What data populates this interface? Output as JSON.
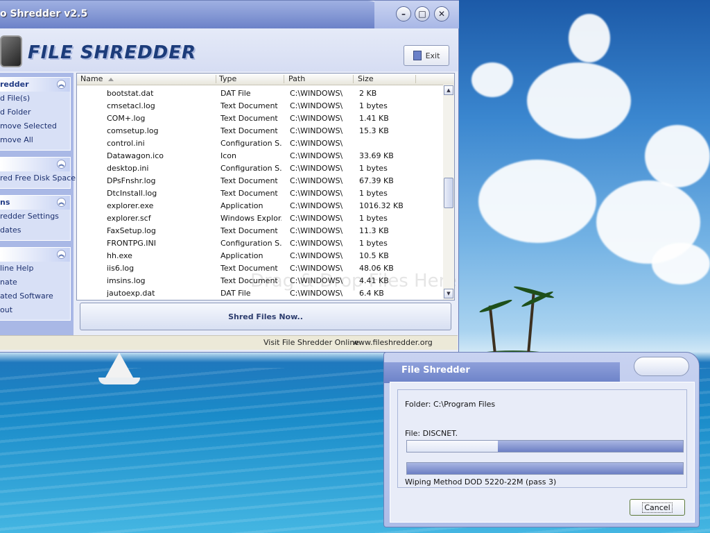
{
  "app": {
    "title": "o Shredder v2.5",
    "logo_text": "FILE SHREDDER",
    "exit_label": "Exit"
  },
  "window_controls": {
    "minimize": "–",
    "maximize": "□",
    "close": "✕"
  },
  "sidebar": {
    "panels": [
      {
        "title": "redder",
        "items": [
          "d File(s)",
          "d Folder",
          "move Selected",
          "move All"
        ]
      },
      {
        "title": "",
        "items": [
          "red Free Disk Space"
        ]
      },
      {
        "title": "ns",
        "items": [
          "redder Settings",
          "dates"
        ]
      },
      {
        "title": "",
        "items": [
          "line Help",
          "nate",
          "ated Software",
          "out"
        ]
      }
    ]
  },
  "file_list": {
    "columns": [
      "Name",
      "Type",
      "Path",
      "Size"
    ],
    "rows": [
      {
        "name": "bootstat.dat",
        "type": "DAT File",
        "path": "C:\\WINDOWS\\",
        "size": "2 KB"
      },
      {
        "name": "cmsetacl.log",
        "type": "Text Document",
        "path": "C:\\WINDOWS\\",
        "size": "1 bytes"
      },
      {
        "name": "COM+.log",
        "type": "Text Document",
        "path": "C:\\WINDOWS\\",
        "size": "1.41 KB"
      },
      {
        "name": "comsetup.log",
        "type": "Text Document",
        "path": "C:\\WINDOWS\\",
        "size": "15.3 KB"
      },
      {
        "name": "control.ini",
        "type": "Configuration S...",
        "path": "C:\\WINDOWS\\",
        "size": ""
      },
      {
        "name": "Datawagon.ico",
        "type": "Icon",
        "path": "C:\\WINDOWS\\",
        "size": "33.69 KB"
      },
      {
        "name": "desktop.ini",
        "type": "Configuration S...",
        "path": "C:\\WINDOWS\\",
        "size": "1 bytes"
      },
      {
        "name": "DPsFnshr.log",
        "type": "Text Document",
        "path": "C:\\WINDOWS\\",
        "size": "67.39 KB"
      },
      {
        "name": "DtcInstall.log",
        "type": "Text Document",
        "path": "C:\\WINDOWS\\",
        "size": "1 bytes"
      },
      {
        "name": "explorer.exe",
        "type": "Application",
        "path": "C:\\WINDOWS\\",
        "size": "1016.32 KB"
      },
      {
        "name": "explorer.scf",
        "type": "Windows Explor...",
        "path": "C:\\WINDOWS\\",
        "size": "1 bytes"
      },
      {
        "name": "FaxSetup.log",
        "type": "Text Document",
        "path": "C:\\WINDOWS\\",
        "size": "11.3 KB"
      },
      {
        "name": "FRONTPG.INI",
        "type": "Configuration S...",
        "path": "C:\\WINDOWS\\",
        "size": "1 bytes"
      },
      {
        "name": "hh.exe",
        "type": "Application",
        "path": "C:\\WINDOWS\\",
        "size": "10.5 KB"
      },
      {
        "name": "iis6.log",
        "type": "Text Document",
        "path": "C:\\WINDOWS\\",
        "size": "48.06 KB"
      },
      {
        "name": "imsins.log",
        "type": "Text Document",
        "path": "C:\\WINDOWS\\",
        "size": "4.41 KB"
      },
      {
        "name": "jautoexp.dat",
        "type": "DAT File",
        "path": "C:\\WINDOWS\\",
        "size": "6.4 KB"
      }
    ],
    "watermark": "Drag & Drop Files Here"
  },
  "shred_button": "Shred Files Now..",
  "statusbar": {
    "visit_text": "Visit File Shredder Online",
    "url": "www.fileshredder.org"
  },
  "dialog": {
    "title": "File Shredder",
    "folder": "Folder: C:\\Program Files",
    "file": "File: DISCNET.",
    "method": "Wiping Method DOD 5220-22M  (pass 3)",
    "cancel": "Cancel",
    "progress_file": 0.33,
    "progress_total": 0.0
  }
}
